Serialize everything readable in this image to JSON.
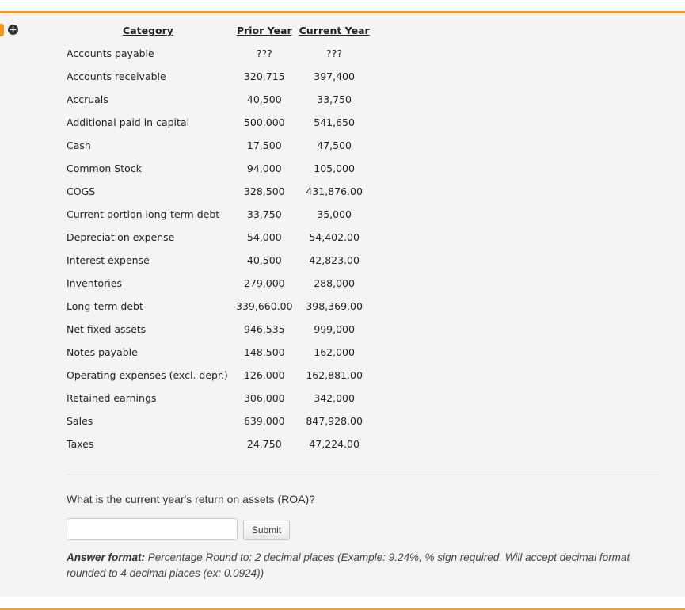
{
  "colors": {
    "accent": "#f7941d",
    "panel_bg": "#f4f4f4"
  },
  "icons": {
    "expand": "plus-circle-icon"
  },
  "table": {
    "headers": {
      "category": "Category",
      "prior_year": "Prior Year",
      "current_year": "Current Year"
    },
    "rows": [
      {
        "category": "Accounts payable",
        "prior_year": "???",
        "current_year": "???"
      },
      {
        "category": "Accounts receivable",
        "prior_year": "320,715",
        "current_year": "397,400"
      },
      {
        "category": "Accruals",
        "prior_year": "40,500",
        "current_year": "33,750"
      },
      {
        "category": "Additional paid in capital",
        "prior_year": "500,000",
        "current_year": "541,650"
      },
      {
        "category": "Cash",
        "prior_year": "17,500",
        "current_year": "47,500"
      },
      {
        "category": "Common Stock",
        "prior_year": "94,000",
        "current_year": "105,000"
      },
      {
        "category": "COGS",
        "prior_year": "328,500",
        "current_year": "431,876.00"
      },
      {
        "category": "Current portion long-term debt",
        "prior_year": "33,750",
        "current_year": "35,000"
      },
      {
        "category": "Depreciation expense",
        "prior_year": "54,000",
        "current_year": "54,402.00"
      },
      {
        "category": "Interest expense",
        "prior_year": "40,500",
        "current_year": "42,823.00"
      },
      {
        "category": "Inventories",
        "prior_year": "279,000",
        "current_year": "288,000"
      },
      {
        "category": "Long-term debt",
        "prior_year": "339,660.00",
        "current_year": "398,369.00"
      },
      {
        "category": "Net fixed assets",
        "prior_year": "946,535",
        "current_year": "999,000"
      },
      {
        "category": "Notes payable",
        "prior_year": "148,500",
        "current_year": "162,000"
      },
      {
        "category": "Operating expenses (excl. depr.)",
        "prior_year": "126,000",
        "current_year": "162,881.00"
      },
      {
        "category": "Retained earnings",
        "prior_year": "306,000",
        "current_year": "342,000"
      },
      {
        "category": "Sales",
        "prior_year": "639,000",
        "current_year": "847,928.00"
      },
      {
        "category": "Taxes",
        "prior_year": "24,750",
        "current_year": "47,224.00"
      }
    ]
  },
  "question": {
    "text": "What is the current year's return on assets (ROA)?",
    "input_value": "",
    "submit_label": "Submit",
    "answer_format_label": "Answer format:",
    "answer_format_text": " Percentage Round to: 2 decimal places (Example: 9.24%, % sign required. Will accept decimal format rounded to 4 decimal places (ex: 0.0924))"
  }
}
